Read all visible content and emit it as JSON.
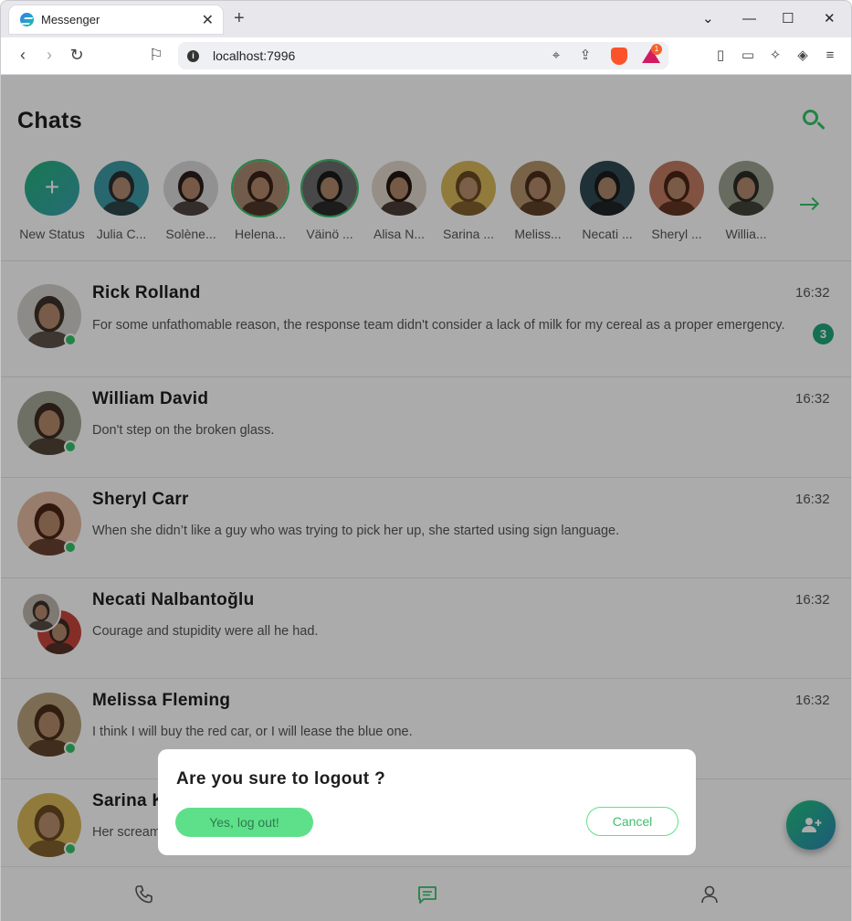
{
  "browser": {
    "tab_title": "Messenger",
    "url": "localhost:7996",
    "rewards_count": "1"
  },
  "page": {
    "title": "Chats"
  },
  "stories": [
    {
      "name": "New Status",
      "colors": [
        "#25b37a",
        "#3aa1b0"
      ],
      "ring": false
    },
    {
      "name": "Julia C...",
      "colors": [
        "#3e9aa6",
        "#2b2f33"
      ],
      "ring": false
    },
    {
      "name": "Solène...",
      "colors": [
        "#d9d9d9",
        "#2a1e1a"
      ],
      "ring": false
    },
    {
      "name": "Helena...",
      "colors": [
        "#a98a70",
        "#3a2218"
      ],
      "ring": true
    },
    {
      "name": "Väinö ...",
      "colors": [
        "#6c6c6c",
        "#1a1a1a"
      ],
      "ring": true
    },
    {
      "name": "Alisa N...",
      "colors": [
        "#e0d5cb",
        "#24170f"
      ],
      "ring": false
    },
    {
      "name": "Sarina ...",
      "colors": [
        "#d8b85a",
        "#6b4a22"
      ],
      "ring": false
    },
    {
      "name": "Meliss...",
      "colors": [
        "#b3936c",
        "#4a2d18"
      ],
      "ring": false
    },
    {
      "name": "Necati ...",
      "colors": [
        "#2f4a52",
        "#1b1b1b"
      ],
      "ring": false
    },
    {
      "name": "Sheryl ...",
      "colors": [
        "#c07a63",
        "#4a2415"
      ],
      "ring": false
    },
    {
      "name": "Willia...",
      "colors": [
        "#9ba08e",
        "#2c2a25"
      ],
      "ring": false
    }
  ],
  "chats": [
    {
      "name": "Rick Rolland",
      "time": "16:32",
      "message": "For some unfathomable reason, the response team didn't consider a lack of milk for my cereal as a proper emergency.",
      "unread": "3",
      "colors": [
        "#d2cfc9",
        "#3d3129"
      ],
      "online": true
    },
    {
      "name": "William David",
      "time": "16:32",
      "message": "Don't step on the broken glass.",
      "unread": "",
      "colors": [
        "#a4a897",
        "#3c2a20"
      ],
      "online": true
    },
    {
      "name": "Sheryl Carr",
      "time": "16:32",
      "message": "When she didn’t like a guy who was trying to pick her up, she started using sign language.",
      "unread": "",
      "colors": [
        "#e3b9a1",
        "#4a2415"
      ],
      "online": true
    },
    {
      "name": "Necati Nalbantoğlu",
      "time": "16:32",
      "message": "Courage and stupidity were all he had.",
      "unread": "",
      "colors": [
        "#bdb7ac",
        "#3d3129"
      ],
      "colors2": [
        "#c7453c",
        "#3b2a22"
      ],
      "online": false
    },
    {
      "name": "Melissa Fleming",
      "time": "16:32",
      "message": "I think I will buy the red car, or I will lease the blue one.",
      "unread": "",
      "colors": [
        "#b9a27c",
        "#4a2d18"
      ],
      "online": true
    },
    {
      "name": "Sarina K",
      "time": "",
      "message": "Her scream",
      "unread": "",
      "colors": [
        "#d8b85a",
        "#6b4a22"
      ],
      "online": true
    }
  ],
  "modal": {
    "title": "Are you sure to logout ?",
    "confirm": "Yes, log out!",
    "cancel": "Cancel"
  },
  "icons": {
    "accent": "#35c46a",
    "nav": [
      "phone-icon",
      "chat-icon",
      "user-icon"
    ]
  }
}
